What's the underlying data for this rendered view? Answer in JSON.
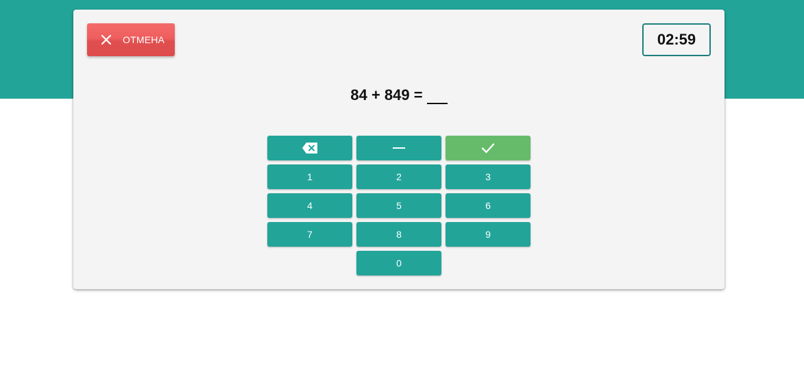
{
  "colors": {
    "accent": "#23a499",
    "cancel": "#ef5e5e",
    "confirm": "#66bb6a",
    "card_bg": "#f4f4f4",
    "timer_border": "#1d7f7b"
  },
  "toolbar": {
    "cancel_label": "ОТМЕНА",
    "cancel_icon": "close-icon"
  },
  "timer": {
    "value": "02:59"
  },
  "equation": {
    "text": "84 + 849 ="
  },
  "keypad": {
    "backspace_icon": "backspace-icon",
    "minus_icon": "minus-icon",
    "confirm_icon": "check-icon",
    "digits": [
      "1",
      "2",
      "3",
      "4",
      "5",
      "6",
      "7",
      "8",
      "9",
      "0"
    ]
  }
}
